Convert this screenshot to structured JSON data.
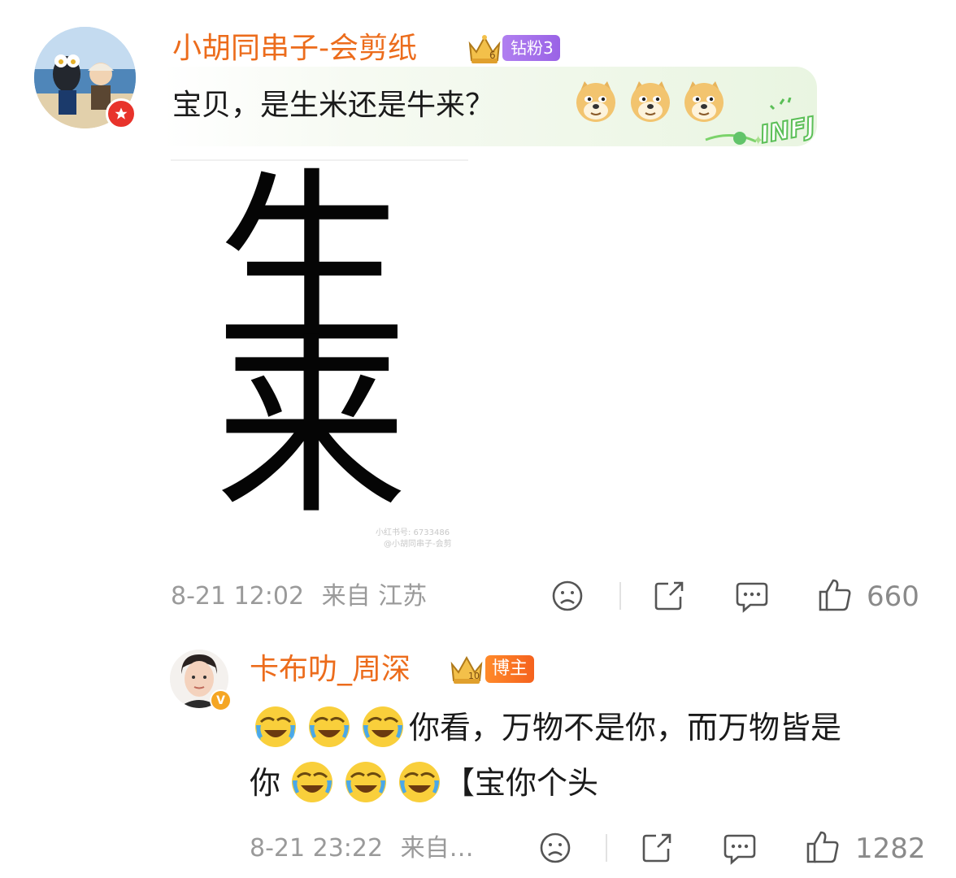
{
  "comments": [
    {
      "username": "小胡同串子-会剪纸",
      "fan_tag": "钻粉3",
      "fan_tag_color": "#a56cec",
      "text": "宝贝，是生米还是牛来？",
      "emoji_icon": "doge-emoji",
      "emoji_count": 3,
      "badge_text": "INFJ",
      "image": {
        "top_char": "生",
        "bottom_char": "来",
        "watermark_line1": "小红书号: 6733486",
        "watermark_line2": "@小胡同串子-会剪"
      },
      "meta": {
        "date": "8-21 12:02",
        "location": "来自 江苏"
      },
      "like_count": "660"
    },
    {
      "username": "卡布叻_周深",
      "role_tag": "博主",
      "role_tag_color": "#f5621e",
      "text_line1": "你看，万物不是你，而万物皆是",
      "text_line2_prefix": "你",
      "text_line2_suffix": "【宝你个头",
      "emoji_icon": "laughing-crying-emoji",
      "meta": {
        "date": "8-21 23:22",
        "location": "来自…"
      },
      "like_count": "1282"
    }
  ],
  "colors": {
    "username": "#ec6c1c",
    "meta_text": "#9a9a9a",
    "accent_red": "#e8332b"
  }
}
